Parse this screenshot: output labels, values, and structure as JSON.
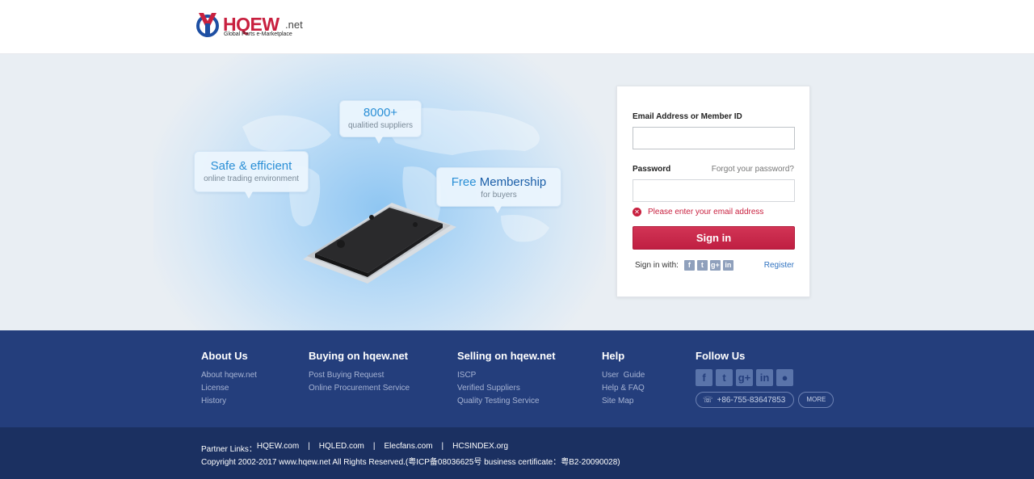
{
  "brand": {
    "name": "HQEW",
    "suffix": ".net",
    "tagline": "Global Parts e-Marketplace",
    "color": "#c8203f"
  },
  "hero": {
    "bubbles": [
      {
        "main_a": "Safe",
        "main_b": " & ",
        "main_c": "efficient",
        "sub": "online trading environment"
      },
      {
        "main": "8000+",
        "sub": "qualitied suppliers"
      },
      {
        "main_a": "Free",
        "main_b": " Membership",
        "sub": "for buyers"
      }
    ]
  },
  "login": {
    "email_label": "Email Address or Member ID",
    "email_value": "",
    "password_label": "Password",
    "password_value": "",
    "forgot_link": "Forgot your password?",
    "error_message": "Please enter your email address",
    "signin_button": "Sign in",
    "signin_with_label": "Sign in with:",
    "social_icons": [
      "facebook-icon",
      "twitter-icon",
      "google-plus-icon",
      "linkedin-icon"
    ],
    "register_link": "Register",
    "accent_color": "#c8284a"
  },
  "footer": {
    "columns": [
      {
        "title": "About Us",
        "links": [
          "About hqew.net",
          "License",
          "History"
        ]
      },
      {
        "title": "Buying on hqew.net",
        "links": [
          "Post Buying Request",
          "Online Procurement Service"
        ]
      },
      {
        "title": "Selling on hqew.net",
        "links": [
          "ISCP",
          "Verified Suppliers",
          "Quality Testing Service"
        ]
      },
      {
        "title": "Help",
        "links": [
          "User  Guide",
          "Help & FAQ",
          "Site Map"
        ]
      }
    ],
    "follow": {
      "title": "Follow Us",
      "icons": [
        "facebook-icon",
        "twitter-icon",
        "google-plus-icon",
        "linkedin-icon",
        "wechat-icon"
      ],
      "phone": "+86-755-83647853",
      "more": "MORE"
    },
    "bg_color": "#243e7c"
  },
  "bottom": {
    "partners_label": "Partner Links：",
    "partners": [
      "HQEW.com",
      "HQLED.com",
      "Elecfans.com",
      "HCSINDEX.org"
    ],
    "separator": "|",
    "copyright": "Copyright 2002-2017 www.hqew.net All Rights Reserved.(粤ICP备08036625号 business certificate：粤B2-20090028)"
  }
}
